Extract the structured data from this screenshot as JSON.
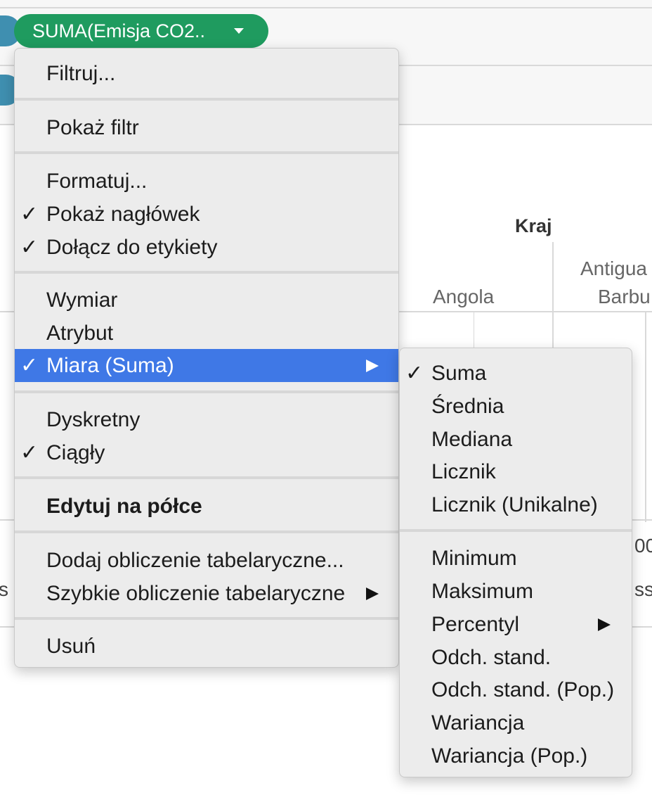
{
  "shelf": {
    "pill_label": "SUMA(Emisja CO2.."
  },
  "view": {
    "header_label": "Kraj",
    "column_angola": "Angola",
    "column_antigua_line1": "Antigua",
    "column_antigua_line2": "Barbu",
    "axis_partial": "00",
    "left_partial": "s p",
    "right_partial": "ss"
  },
  "context_menu": {
    "items": [
      {
        "label": "Filtruj...",
        "checked": false
      },
      {
        "label": "Pokaż filtr",
        "checked": false
      },
      {
        "label": "Formatuj...",
        "checked": false
      },
      {
        "label": "Pokaż nagłówek",
        "checked": true
      },
      {
        "label": "Dołącz do etykiety",
        "checked": true
      },
      {
        "label": "Wymiar",
        "checked": false
      },
      {
        "label": "Atrybut",
        "checked": false
      },
      {
        "label": "Miara (Suma)",
        "checked": true,
        "highlighted": true,
        "has_submenu": true
      },
      {
        "label": "Dyskretny",
        "checked": false
      },
      {
        "label": "Ciągły",
        "checked": true
      },
      {
        "label": "Edytuj na półce",
        "checked": false
      },
      {
        "label": "Dodaj obliczenie tabelaryczne...",
        "checked": false
      },
      {
        "label": "Szybkie obliczenie tabelaryczne",
        "checked": false,
        "has_submenu": true
      },
      {
        "label": "Usuń",
        "checked": false
      }
    ],
    "check_glyph": "✓"
  },
  "measure_submenu": {
    "items": [
      {
        "label": "Suma",
        "checked": true
      },
      {
        "label": "Średnia",
        "checked": false
      },
      {
        "label": "Mediana",
        "checked": false
      },
      {
        "label": "Licznik",
        "checked": false
      },
      {
        "label": "Licznik (Unikalne)",
        "checked": false
      },
      {
        "label": "Minimum",
        "checked": false
      },
      {
        "label": "Maksimum",
        "checked": false
      },
      {
        "label": "Percentyl",
        "checked": false,
        "has_submenu": true
      },
      {
        "label": "Odch. stand.",
        "checked": false
      },
      {
        "label": "Odch. stand. (Pop.)",
        "checked": false
      },
      {
        "label": "Wariancja",
        "checked": false
      },
      {
        "label": "Wariancja (Pop.)",
        "checked": false
      }
    ]
  },
  "colors": {
    "pill_green": "#1f9b5f",
    "highlight_blue": "#3f78e6",
    "menu_bg": "#ececec"
  }
}
